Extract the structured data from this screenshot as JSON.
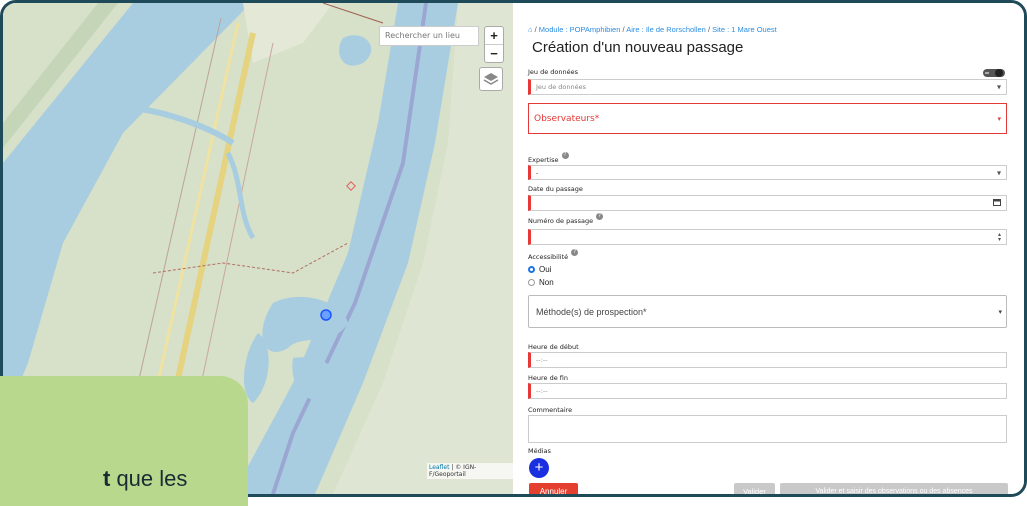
{
  "map": {
    "search_placeholder": "Rechercher un lieu",
    "zoom_in": "+",
    "zoom_out": "−",
    "attribution_link": "Leaflet",
    "attribution_rest": " | © IGN-F/Geoportail"
  },
  "overlay": {
    "text_bold": "t",
    "text_rest": " que les"
  },
  "form": {
    "breadcrumb": {
      "home_icon": "home-icon",
      "module": "Module : POPAmphibien",
      "aire": "Aire : Ile de Rorschollen",
      "site": "Site : 1 Mare Ouest",
      "sep": " / "
    },
    "title": "Création d'un nouveau passage",
    "jeu_label": "Jeu de données",
    "jeu_placeholder": "Jeu de données",
    "observateurs_placeholder": "Observateurs*",
    "expertise_label": "Expertise",
    "expertise_value": "-",
    "date_label": "Date du passage",
    "numero_label": "Numéro de passage",
    "accessibilite_label": "Accessibilité",
    "radio_oui": "Oui",
    "radio_non": "Non",
    "methode_placeholder": "Méthode(s) de prospection*",
    "heure_debut_label": "Heure de début",
    "heure_debut_placeholder": "--:--",
    "heure_fin_label": "Heure de fin",
    "heure_fin_placeholder": "--:--",
    "commentaire_label": "Commentaire",
    "medias_label": "Médias",
    "add_media": "+",
    "btn_annuler": "Annuler",
    "btn_valider": "Valider",
    "btn_valider_saisir": "Valider et saisir des observations ou des absences",
    "help_glyph": "?"
  },
  "colors": {
    "accent": "#1a73e8",
    "required": "#e53935",
    "frame": "#1f4a5a",
    "overlay": "#b8d98d"
  }
}
